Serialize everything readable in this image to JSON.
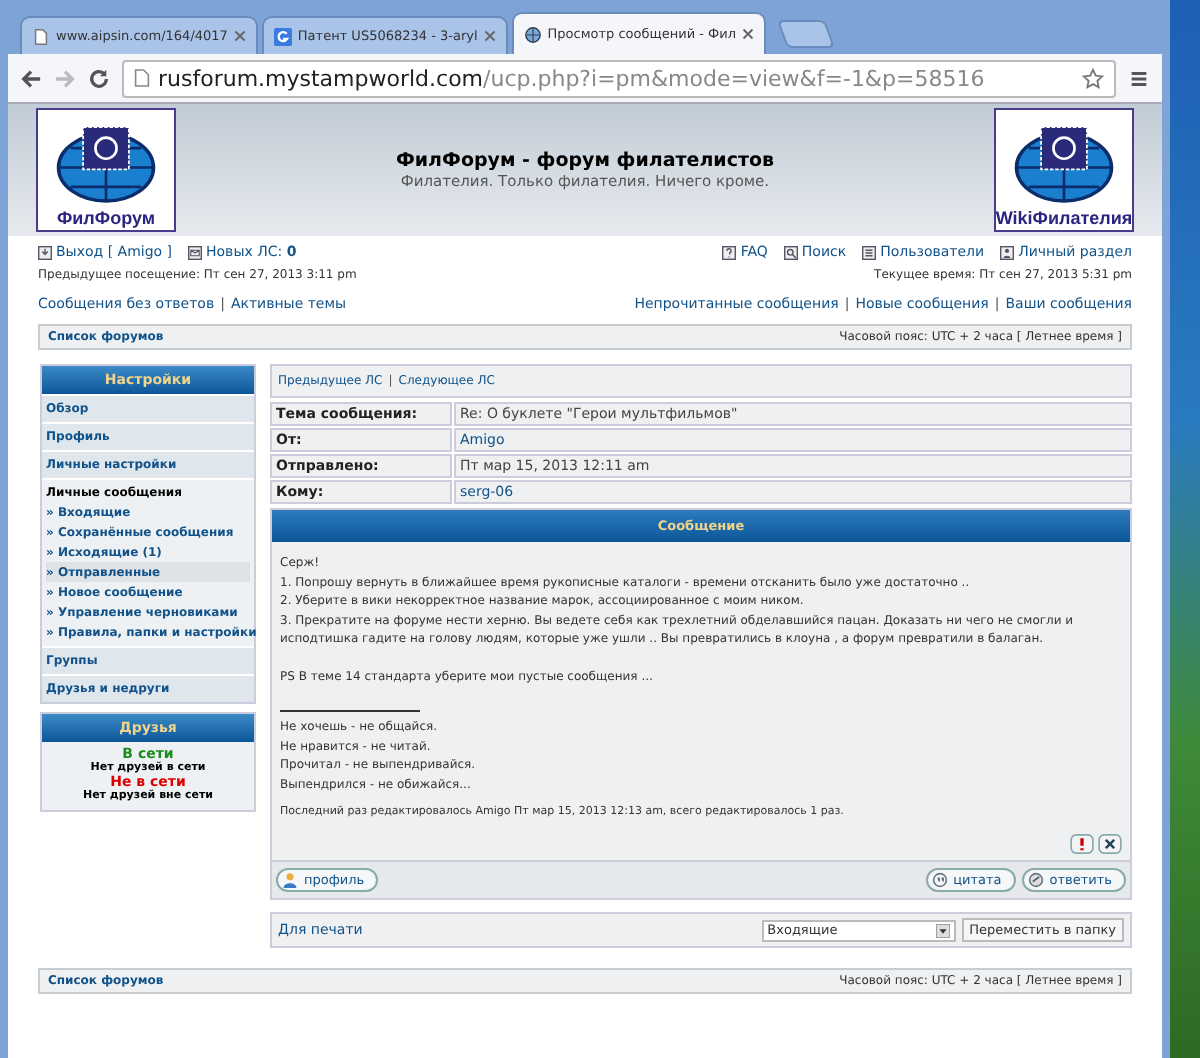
{
  "browser": {
    "tabs": [
      {
        "title": "www.aipsin.com/164/4017",
        "selected": false,
        "kind": "page"
      },
      {
        "title": "Патент US5068234 - 3-aryl",
        "selected": false,
        "kind": "google"
      },
      {
        "title": "Просмотр сообщений - Фил",
        "selected": true,
        "kind": "forum"
      }
    ],
    "url_host": "rusforum.mystampworld.com",
    "url_path": "/ucp.php?i=pm&mode=view&f=-1&p=58516"
  },
  "header": {
    "logo_left": "ФилФорум",
    "title": "ФилФорум - форум филателистов",
    "subtitle": "Филателия. Только филателия. Ничего кроме.",
    "logo_right": "WikiФилателия"
  },
  "userbar": {
    "left": [
      {
        "label": "Выход [ Amigo ]",
        "kind": "logout"
      },
      {
        "label": "Новых ЛС: **0**",
        "kind": "pm"
      }
    ],
    "right": [
      {
        "label": "FAQ",
        "kind": "faq"
      },
      {
        "label": "Поиск",
        "kind": "search"
      },
      {
        "label": "Пользователи",
        "kind": "members"
      },
      {
        "label": "Личный раздел",
        "kind": "ucp"
      }
    ]
  },
  "visits": {
    "previous": "Предыдущее посещение: Пт сен 27, 2013 3:11 pm",
    "current": "Текущее время: Пт сен 27, 2013 5:31 pm"
  },
  "quick_links": {
    "separator": "|",
    "left": [
      "Сообщения без ответов",
      "Активные темы"
    ],
    "right": [
      "Непрочитанные сообщения",
      "Новые сообщения",
      "Ваши сообщения"
    ]
  },
  "breadcrumb": {
    "label": "Список форумов",
    "timezone": "Часовой пояс: UTC + 2 часа [ Летнее время ]"
  },
  "sidebar": {
    "title": "Настройки",
    "sections": [
      {
        "label": "Обзор",
        "expanded": false
      },
      {
        "label": "Профиль",
        "expanded": false
      },
      {
        "label": "Личные настройки",
        "expanded": false
      },
      {
        "label": "Личные сообщения",
        "expanded": true,
        "children": [
          {
            "label": "» Входящие",
            "selected": false
          },
          {
            "label": "» Сохранённые сообщения",
            "selected": false
          },
          {
            "label": "» Исходящие (1)",
            "selected": false
          },
          {
            "label": "» Отправленные",
            "selected": true
          },
          {
            "label": "» Новое сообщение",
            "selected": false
          },
          {
            "label": "» Управление черновиками",
            "selected": false
          },
          {
            "label": "» Правила, папки и настройки",
            "selected": false
          }
        ]
      },
      {
        "label": "Группы",
        "expanded": false
      },
      {
        "label": "Друзья и недруги",
        "expanded": false
      }
    ]
  },
  "friends": {
    "title": "Друзья",
    "groups": [
      {
        "kind": "online",
        "label": "В сети",
        "empty": "Нет друзей в сети"
      },
      {
        "kind": "offline",
        "label": "Не в сети",
        "empty": "Нет друзей вне сети"
      }
    ]
  },
  "message": {
    "nav": [
      "Предыдущее ЛС",
      "Следующее ЛС"
    ],
    "fields": [
      {
        "label": "Тема сообщения:",
        "value": "Re: О буклете \"Герои мультфильмов\"",
        "kind": "text"
      },
      {
        "label": "От:",
        "value": "Amigo",
        "kind": "link"
      },
      {
        "label": "Отправлено:",
        "value": "Пт мар 15, 2013 12:11 am",
        "kind": "text"
      },
      {
        "label": "Кому:",
        "value": "serg-06",
        "kind": "link"
      }
    ],
    "heading": "Сообщение",
    "body": [
      {
        "lines": [
          "Серж!",
          "1. Попрошу вернуть в ближайшее время рукописные каталоги - времени отсканить было уже достаточно ..",
          "2. Уберите в вики некорректное название марок, ассоциированное с моим ником.",
          "3. Прекратите на форуме нести херню. Вы ведете себя как трехлетний обделавшийся пацан. Доказать ни чего не смогли и исподтишка гадите на голову людям, которые уже ушли .. Вы превратились в клоуна , а форум превратили в балаган."
        ]
      },
      {
        "lines": [
          "PS В теме 14 стандарта уберите мои пустые сообщения ..."
        ]
      }
    ],
    "signature": [
      "Не хочешь - не общайся.",
      "Не нравится - не читай.",
      "Прочитал - не выпендривайся.",
      "Выпендрился - не обижайся..."
    ],
    "edit_note": "Последний раз редактировалось Amigo Пт мар 15, 2013 12:13 am, всего редактировалось 1 раз.",
    "profile_button": "профиль",
    "quote_button": "цитата",
    "reply_button": "ответить"
  },
  "footer_bar": {
    "print": "Для печати",
    "folder": "Входящие",
    "move_button": "Переместить в папку"
  },
  "bottom_bar": {
    "label": "Список форумов",
    "timezone": "Часовой пояс: UTC + 2 часа [ Летнее время ]"
  }
}
